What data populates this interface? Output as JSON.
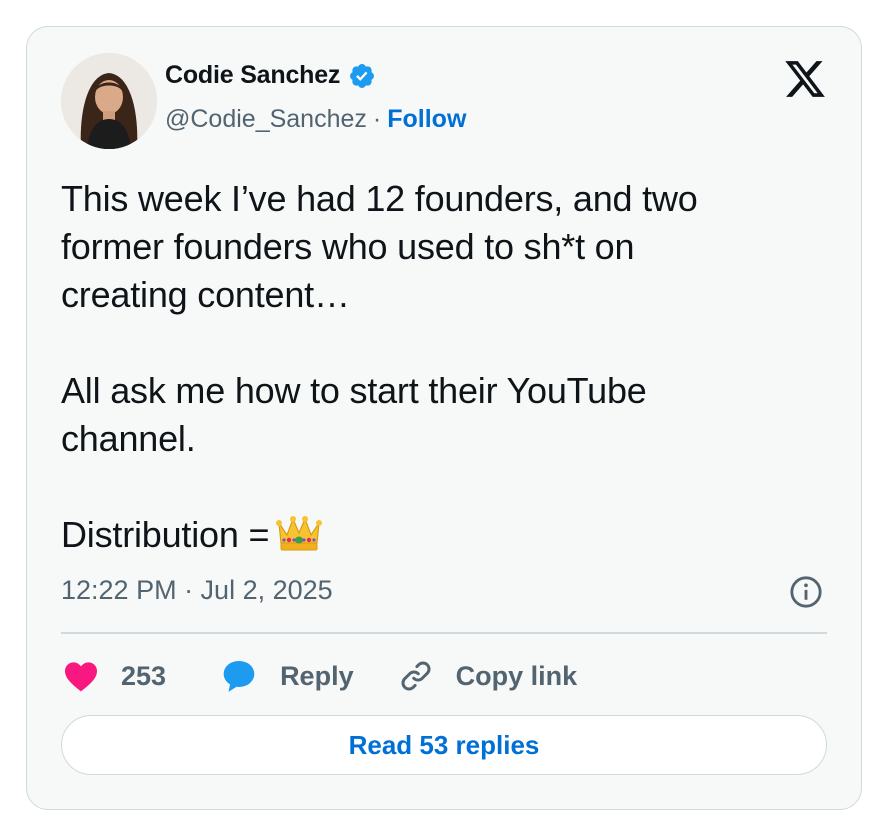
{
  "author": {
    "name": "Codie Sanchez",
    "handle": "@Codie_Sanchez",
    "separator": "·",
    "follow_label": "Follow"
  },
  "icons": {
    "avatar": "avatar",
    "verified": "verified-badge-icon",
    "brand": "x-logo-icon",
    "info": "info-icon",
    "like": "heart-icon",
    "reply": "speech-bubble-icon",
    "copy": "link-icon",
    "emoji": "crown-emoji"
  },
  "colors": {
    "verified": "#1d9bf0",
    "link": "#006fd6",
    "like": "#f91880",
    "reply": "#1d9bf0",
    "text": "#0f1419",
    "secondary": "#536471"
  },
  "tweet": {
    "text": "This week I’ve had 12 founders, and two\nformer founders who used to sh*t on\ncreating content…\n\nAll ask me how to start their YouTube\nchannel.\n\nDistribution =",
    "emoji": "👑",
    "timestamp": "12:22 PM · Jul 2, 2025"
  },
  "actions": {
    "like_count": "253",
    "reply_label": "Reply",
    "copy_label": "Copy link"
  },
  "footer": {
    "read_replies_label": "Read 53 replies"
  }
}
